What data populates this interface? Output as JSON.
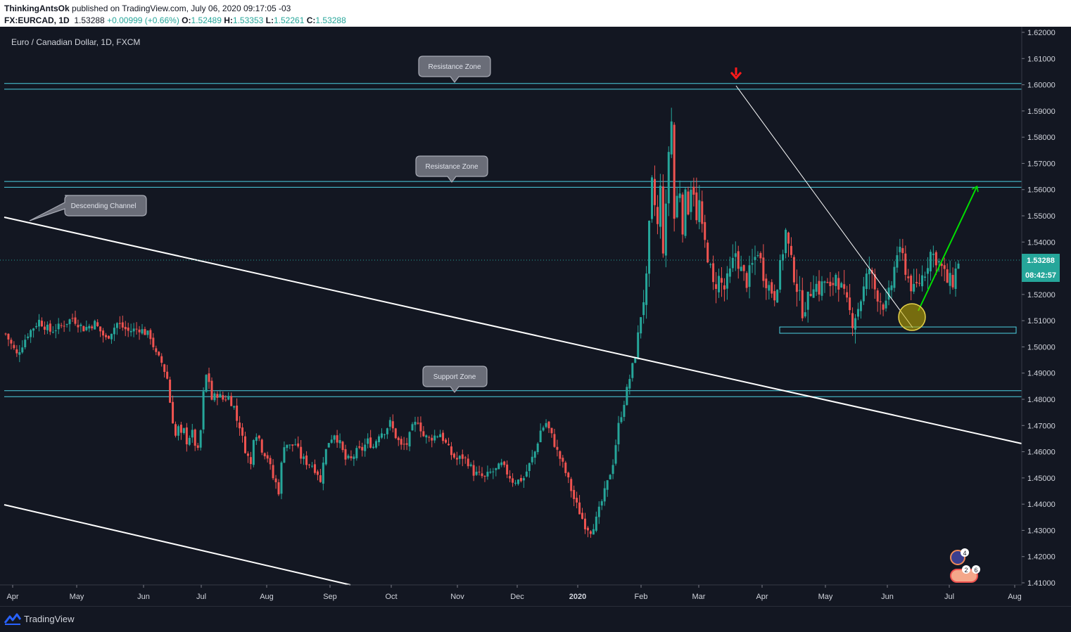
{
  "header": {
    "author": "ThinkingAntsOk",
    "published": "published on TradingView.com, July 06, 2020 09:17:05 -03",
    "symbol": "FX:EURCAD, 1D",
    "last": "1.53288",
    "change": "+0.00999 (+0.66%)",
    "o_label": "O:",
    "o": "1.52489",
    "h_label": "H:",
    "h": "1.53353",
    "l_label": "L:",
    "l": "1.52261",
    "c_label": "C:",
    "c": "1.53288"
  },
  "chart_title": "Euro / Canadian Dollar, 1D, FXCM",
  "footer": {
    "brand": "TradingView"
  },
  "colors": {
    "background": "#131722",
    "up": "#26a69a",
    "down": "#ef5350",
    "zone": "#4dd0e1",
    "trend": "#ffffff",
    "target_arrow": "#00e000",
    "top_arrow": "#ff1a1a",
    "price_tag": "#26a69a"
  },
  "annotations": {
    "resistance_top": "Resistance Zone",
    "resistance_mid": "Resistance Zone",
    "support": "Support Zone",
    "channel": "Descending Channel"
  },
  "price_tag": {
    "price": "1.53288",
    "countdown": "08:42:57"
  },
  "badges": {
    "b1": "4",
    "b2": "2",
    "b3": "6"
  },
  "chart_data": {
    "type": "candlestick",
    "title": "Euro / Canadian Dollar, 1D, FXCM",
    "ylim": [
      1.41,
      1.62
    ],
    "y_ticks": [
      "1.62000",
      "1.61000",
      "1.60000",
      "1.59000",
      "1.58000",
      "1.57000",
      "1.56000",
      "1.55000",
      "1.54000",
      "1.53000",
      "1.52000",
      "1.51000",
      "1.50000",
      "1.49000",
      "1.48000",
      "1.47000",
      "1.46000",
      "1.45000",
      "1.44000",
      "1.43000",
      "1.42000",
      "1.41000"
    ],
    "x_ticks": [
      "Apr",
      "May",
      "Jun",
      "Jul",
      "Aug",
      "Sep",
      "Oct",
      "Nov",
      "Dec",
      "2020",
      "Feb",
      "Mar",
      "Apr",
      "May",
      "Jun",
      "Jul",
      "Aug"
    ],
    "series_path": [
      [
        0,
        1.505
      ],
      [
        4,
        1.497
      ],
      [
        8,
        1.505
      ],
      [
        12,
        1.51
      ],
      [
        16,
        1.506
      ],
      [
        20,
        1.508
      ],
      [
        24,
        1.511
      ],
      [
        28,
        1.507
      ],
      [
        32,
        1.509
      ],
      [
        36,
        1.503
      ],
      [
        40,
        1.509
      ],
      [
        44,
        1.506
      ],
      [
        48,
        1.507
      ],
      [
        52,
        1.504
      ],
      [
        54,
        1.497
      ],
      [
        56,
        1.494
      ],
      [
        58,
        1.488
      ],
      [
        59,
        1.479
      ],
      [
        60,
        1.472
      ],
      [
        61,
        1.466
      ],
      [
        62,
        1.469
      ],
      [
        63,
        1.466
      ],
      [
        64,
        1.468
      ],
      [
        65,
        1.464
      ],
      [
        66,
        1.466
      ],
      [
        67,
        1.467
      ],
      [
        68,
        1.463
      ],
      [
        69,
        1.46
      ],
      [
        70,
        1.468
      ],
      [
        71,
        1.482
      ],
      [
        72,
        1.489
      ],
      [
        73,
        1.487
      ],
      [
        74,
        1.48
      ],
      [
        76,
        1.482
      ],
      [
        78,
        1.48
      ],
      [
        80,
        1.481
      ],
      [
        82,
        1.477
      ],
      [
        83,
        1.472
      ],
      [
        84,
        1.47
      ],
      [
        85,
        1.465
      ],
      [
        86,
        1.461
      ],
      [
        87,
        1.458
      ],
      [
        88,
        1.455
      ],
      [
        89,
        1.466
      ],
      [
        90,
        1.467
      ],
      [
        91,
        1.465
      ],
      [
        92,
        1.461
      ],
      [
        94,
        1.458
      ],
      [
        95,
        1.454
      ],
      [
        96,
        1.45
      ],
      [
        97,
        1.448
      ],
      [
        98,
        1.445
      ],
      [
        99,
        1.455
      ],
      [
        100,
        1.463
      ],
      [
        101,
        1.463
      ],
      [
        102,
        1.462
      ],
      [
        104,
        1.463
      ],
      [
        106,
        1.458
      ],
      [
        108,
        1.456
      ],
      [
        110,
        1.455
      ],
      [
        112,
        1.452
      ],
      [
        113,
        1.448
      ],
      [
        114,
        1.457
      ],
      [
        116,
        1.464
      ],
      [
        118,
        1.467
      ],
      [
        120,
        1.463
      ],
      [
        122,
        1.457
      ],
      [
        124,
        1.457
      ],
      [
        126,
        1.46
      ],
      [
        128,
        1.461
      ],
      [
        130,
        1.464
      ],
      [
        132,
        1.462
      ],
      [
        134,
        1.467
      ],
      [
        136,
        1.468
      ],
      [
        138,
        1.471
      ],
      [
        140,
        1.466
      ],
      [
        142,
        1.462
      ],
      [
        144,
        1.463
      ],
      [
        146,
        1.469
      ],
      [
        148,
        1.472
      ],
      [
        150,
        1.466
      ],
      [
        152,
        1.465
      ],
      [
        154,
        1.466
      ],
      [
        156,
        1.467
      ],
      [
        158,
        1.463
      ],
      [
        160,
        1.459
      ],
      [
        162,
        1.457
      ],
      [
        164,
        1.458
      ],
      [
        166,
        1.456
      ],
      [
        168,
        1.452
      ],
      [
        170,
        1.451
      ],
      [
        172,
        1.45
      ],
      [
        174,
        1.452
      ],
      [
        176,
        1.453
      ],
      [
        178,
        1.455
      ],
      [
        180,
        1.452
      ],
      [
        182,
        1.449
      ],
      [
        184,
        1.449
      ],
      [
        186,
        1.45
      ],
      [
        188,
        1.455
      ],
      [
        190,
        1.46
      ],
      [
        192,
        1.468
      ],
      [
        194,
        1.471
      ],
      [
        196,
        1.466
      ],
      [
        198,
        1.46
      ],
      [
        200,
        1.455
      ],
      [
        202,
        1.449
      ],
      [
        204,
        1.442
      ],
      [
        206,
        1.437
      ],
      [
        208,
        1.432
      ],
      [
        210,
        1.43
      ],
      [
        212,
        1.434
      ],
      [
        214,
        1.441
      ],
      [
        216,
        1.448
      ],
      [
        218,
        1.456
      ],
      [
        220,
        1.47
      ],
      [
        222,
        1.479
      ],
      [
        224,
        1.488
      ],
      [
        226,
        1.497
      ],
      [
        228,
        1.512
      ],
      [
        230,
        1.525
      ],
      [
        231,
        1.545
      ],
      [
        232,
        1.562
      ],
      [
        233,
        1.554
      ],
      [
        234,
        1.546
      ],
      [
        235,
        1.56
      ],
      [
        236,
        1.538
      ],
      [
        237,
        1.552
      ],
      [
        238,
        1.575
      ],
      [
        239,
        1.586
      ],
      [
        240,
        1.549
      ],
      [
        241,
        1.557
      ],
      [
        242,
        1.56
      ],
      [
        243,
        1.546
      ],
      [
        244,
        1.557
      ],
      [
        245,
        1.553
      ],
      [
        246,
        1.562
      ],
      [
        247,
        1.56
      ],
      [
        248,
        1.547
      ],
      [
        249,
        1.555
      ],
      [
        250,
        1.544
      ],
      [
        252,
        1.535
      ],
      [
        254,
        1.523
      ],
      [
        256,
        1.526
      ],
      [
        258,
        1.522
      ],
      [
        260,
        1.528
      ],
      [
        262,
        1.536
      ],
      [
        264,
        1.529
      ],
      [
        266,
        1.525
      ],
      [
        268,
        1.531
      ],
      [
        270,
        1.537
      ],
      [
        272,
        1.528
      ],
      [
        274,
        1.523
      ],
      [
        276,
        1.52
      ],
      [
        278,
        1.53
      ],
      [
        280,
        1.544
      ],
      [
        282,
        1.532
      ],
      [
        284,
        1.523
      ],
      [
        286,
        1.514
      ],
      [
        288,
        1.518
      ],
      [
        290,
        1.525
      ],
      [
        292,
        1.522
      ],
      [
        294,
        1.525
      ],
      [
        296,
        1.521
      ],
      [
        298,
        1.528
      ],
      [
        300,
        1.522
      ],
      [
        302,
        1.516
      ],
      [
        304,
        1.51
      ],
      [
        306,
        1.515
      ],
      [
        308,
        1.522
      ],
      [
        310,
        1.53
      ],
      [
        312,
        1.522
      ],
      [
        314,
        1.518
      ],
      [
        316,
        1.515
      ],
      [
        318,
        1.524
      ],
      [
        320,
        1.536
      ],
      [
        322,
        1.534
      ],
      [
        324,
        1.526
      ],
      [
        326,
        1.521
      ],
      [
        328,
        1.525
      ],
      [
        330,
        1.529
      ],
      [
        332,
        1.536
      ],
      [
        334,
        1.534
      ],
      [
        336,
        1.53
      ],
      [
        338,
        1.525
      ],
      [
        340,
        1.525
      ],
      [
        342,
        1.533
      ]
    ],
    "horizontal_zones": [
      {
        "name": "Resistance Zone",
        "from": 1.5983,
        "to": 1.6005
      },
      {
        "name": "Resistance Zone",
        "from": 1.5609,
        "to": 1.5631
      },
      {
        "name": "Support Zone",
        "from": 1.481,
        "to": 1.4833
      },
      {
        "name": "",
        "from": 1.5052,
        "to": 1.5076
      }
    ]
  }
}
